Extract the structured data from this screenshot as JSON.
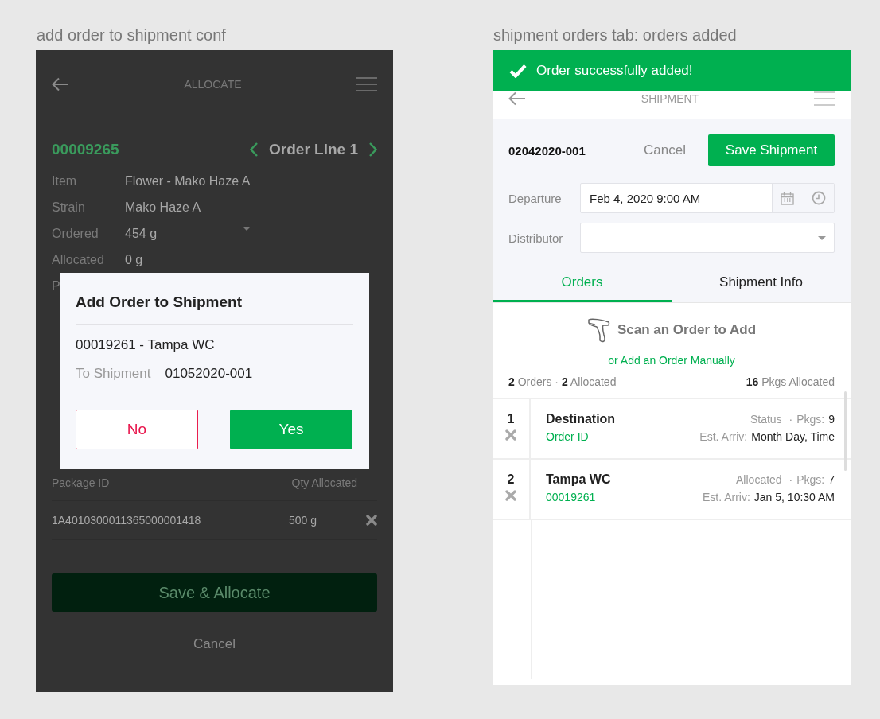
{
  "panels_titles": [
    "add order to shipment conf",
    "shipment orders tab: orders added"
  ],
  "allocate": {
    "header": {
      "title": "ALLOCATE"
    },
    "order_id": "00009265",
    "order_line": "Order Line 1",
    "details": [
      {
        "label": "Item",
        "value": "Flower - Mako Haze A"
      },
      {
        "label": "Strain",
        "value": "Mako Haze A"
      },
      {
        "label": "Ordered",
        "value": "454 g"
      },
      {
        "label": "Allocated",
        "value": "0 g"
      },
      {
        "label": "P"
      }
    ],
    "packages": {
      "columns": [
        "Package ID",
        "Qty Allocated"
      ],
      "rows": [
        {
          "package_id": "1A4010300011365000001418",
          "qty": "500 g"
        }
      ]
    },
    "buttons": [
      {
        "label": "Save & Allocate",
        "kind": "primary"
      },
      {
        "label": "Cancel",
        "kind": "text"
      }
    ],
    "dialog": {
      "title": "Add Order to Shipment",
      "order": "00019261 - Tampa WC",
      "shipment_label": "To Shipment",
      "shipment": "01052020-001",
      "buttons": [
        {
          "label": "No",
          "kind": "secondary"
        },
        {
          "label": "Yes",
          "kind": "primary"
        }
      ]
    }
  },
  "shipment": {
    "toast": "Order successfully added!",
    "header": {
      "title": "SHIPMENT"
    },
    "shipment_id": "02042020-001",
    "cancel": "Cancel",
    "save": "Save Shipment",
    "departure": {
      "label": "Departure",
      "value": "Feb 4, 2020 9:00 AM"
    },
    "distributor": {
      "label": "Distributor"
    },
    "tabs": [
      {
        "label": "Orders",
        "selected": true
      },
      {
        "label": "Shipment Info",
        "selected": false
      }
    ],
    "scan": "Scan an Order to Add",
    "manual_link": "or Add an Order Manually",
    "summary": "**2** Orders  ·  **2** Allocated",
    "pkgs_summary": "**16** Pkgs Allocated",
    "separator": "·",
    "orders": [
      {
        "number": "1",
        "destination": "Destination",
        "order_id": "Order ID",
        "status": "Status",
        "pkgs_label": "Pkgs:",
        "pkgs": "9",
        "arrival_label": "Est. Arriv:",
        "arrival": "Month Day, Time"
      },
      {
        "number": "2",
        "destination": "Tampa WC",
        "order_id": "00019261",
        "status": "Allocated",
        "pkgs_label": "Pkgs:",
        "pkgs": "7",
        "arrival_label": "Est. Arriv:",
        "arrival": "Jan 5, 10:30 AM"
      }
    ]
  }
}
